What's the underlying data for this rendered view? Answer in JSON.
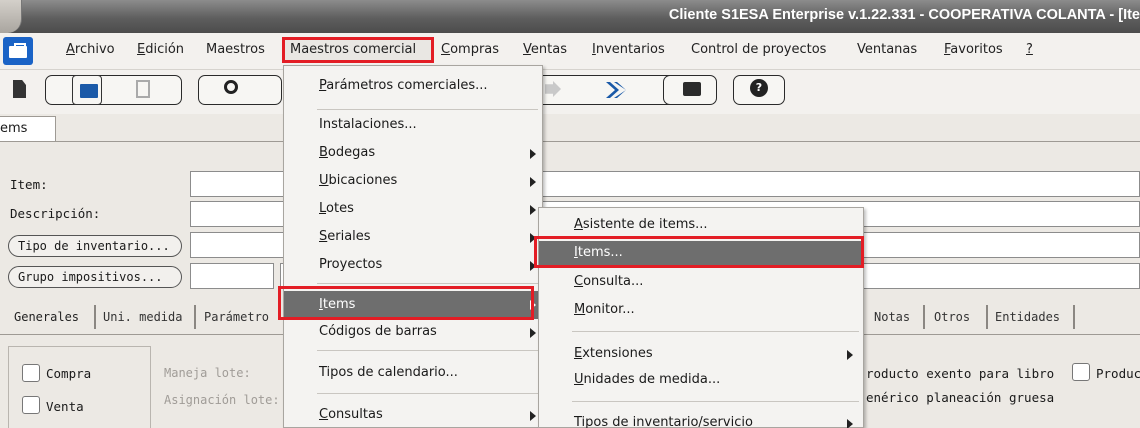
{
  "window": {
    "title": "Cliente S1ESA Enterprise v.1.22.331 - COOPERATIVA COLANTA - [Ite"
  },
  "menubar": {
    "items": [
      {
        "label": "Archivo",
        "ul": "A"
      },
      {
        "label": "Edición",
        "ul": "E"
      },
      {
        "label": "Maestros",
        "ul": ""
      },
      {
        "label": "Maestros comercial",
        "ul": ""
      },
      {
        "label": "Compras",
        "ul": "C"
      },
      {
        "label": "Ventas",
        "ul": "V"
      },
      {
        "label": "Inventarios",
        "ul": "I"
      },
      {
        "label": "Control de proyectos",
        "ul": ""
      },
      {
        "label": "Ventanas",
        "ul": ""
      },
      {
        "label": "Favoritos",
        "ul": "F"
      },
      {
        "label": "?",
        "ul": "?"
      }
    ]
  },
  "toolbar": {
    "icons": [
      "new-document-icon",
      "open-folder-icon",
      "copy-icon",
      "search-icon",
      "next-icon",
      "last-icon",
      "print-icon",
      "help-icon"
    ]
  },
  "form": {
    "tab": "ems",
    "item_label": "Item:",
    "description_label": "Descripción:",
    "tipo_inventario_button": "Tipo de inventario...",
    "grupo_impositivos_button": "Grupo impositivos..."
  },
  "lower_tabs": [
    "Generales",
    "Uni. medida",
    "Parámetro",
    "Notas",
    "Otros",
    "Entidades"
  ],
  "general": {
    "compra": "Compra",
    "venta": "Venta",
    "maneja_lote": "Maneja lote:",
    "asignacion_lote": "Asignación lote:",
    "producto_exento": "roducto exento para libro",
    "producto": "Produc",
    "generico_planeacion": "enérico planeación gruesa"
  },
  "menu_comercial": {
    "items": [
      {
        "label": "Parámetros comerciales...",
        "ul": "P"
      },
      {
        "label": "Instalaciones...",
        "ul": ""
      },
      {
        "label": "Bodegas",
        "ul": "B",
        "submenu": true
      },
      {
        "label": "Ubicaciones",
        "ul": "U",
        "submenu": true
      },
      {
        "label": "Lotes",
        "ul": "L",
        "submenu": true
      },
      {
        "label": "Seriales",
        "ul": "S",
        "submenu": true
      },
      {
        "label": "Proyectos",
        "ul": "",
        "submenu": true
      },
      {
        "label": "Items",
        "ul": "I",
        "submenu": true,
        "selected": true
      },
      {
        "label": "Códigos de barras",
        "ul": "",
        "submenu": true
      },
      {
        "label": "Tipos de calendario...",
        "ul": "",
        "submenu": false
      },
      {
        "label": "Consultas",
        "ul": "C",
        "submenu": true
      }
    ]
  },
  "menu_items": {
    "items": [
      {
        "label": "Asistente de items...",
        "ul": "A"
      },
      {
        "label": "Items...",
        "ul": "I",
        "selected": true
      },
      {
        "label": "Consulta...",
        "ul": "C"
      },
      {
        "label": "Monitor...",
        "ul": "M"
      },
      {
        "label": "Extensiones",
        "ul": "E",
        "submenu": true
      },
      {
        "label": "Unidades de medida...",
        "ul": "U"
      },
      {
        "label": "Tipos de inventario/servicio",
        "ul": "",
        "submenu": true
      }
    ]
  },
  "colors": {
    "highlight": "#e31d25",
    "selected_bg": "#6e6e6e",
    "titlebar": "#5e5e5e"
  }
}
